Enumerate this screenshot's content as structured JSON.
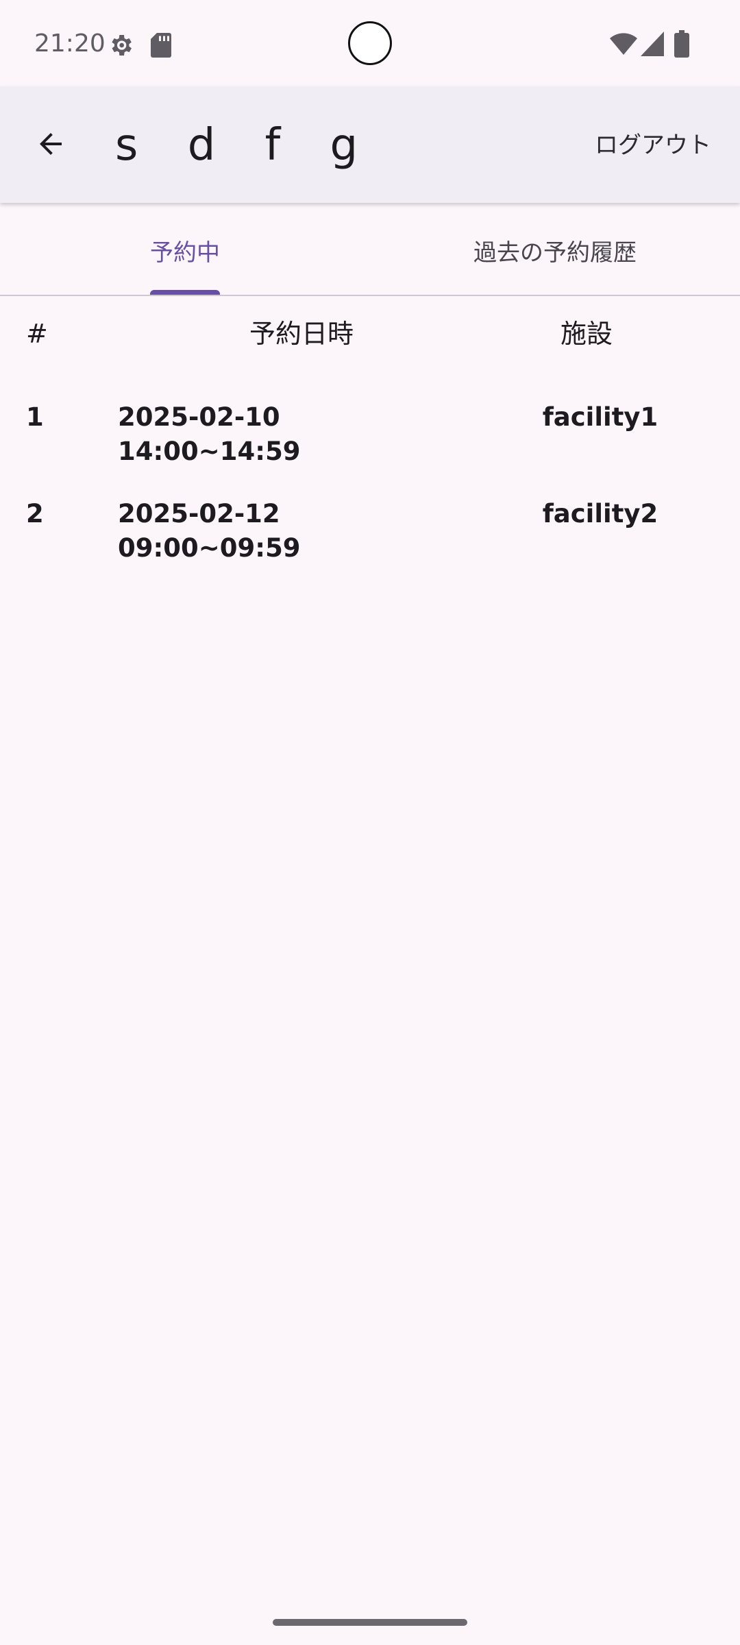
{
  "status_bar": {
    "time": "21:20",
    "icons": [
      "settings-gear-icon",
      "sd-card-icon",
      "wifi-icon",
      "cell-signal-icon",
      "battery-icon"
    ]
  },
  "app_bar": {
    "title": "s d f g",
    "back_icon": "arrow-back-icon",
    "logout_label": "ログアウト"
  },
  "tabs": [
    {
      "label": "予約中",
      "selected": true
    },
    {
      "label": "過去の予約履歴",
      "selected": false
    }
  ],
  "table": {
    "headers": {
      "num": "#",
      "datetime": "予約日時",
      "facility": "施設"
    },
    "rows": [
      {
        "num": "1",
        "datetime": "2025-02-10 14:00~14:59",
        "facility": "facility1"
      },
      {
        "num": "2",
        "datetime": "2025-02-12 09:00~09:59",
        "facility": "facility2"
      }
    ]
  },
  "colors": {
    "background": "#fcf6fb",
    "app_bar": "#f1edf4",
    "accent": "#6750a4",
    "text": "#1d1b20"
  }
}
